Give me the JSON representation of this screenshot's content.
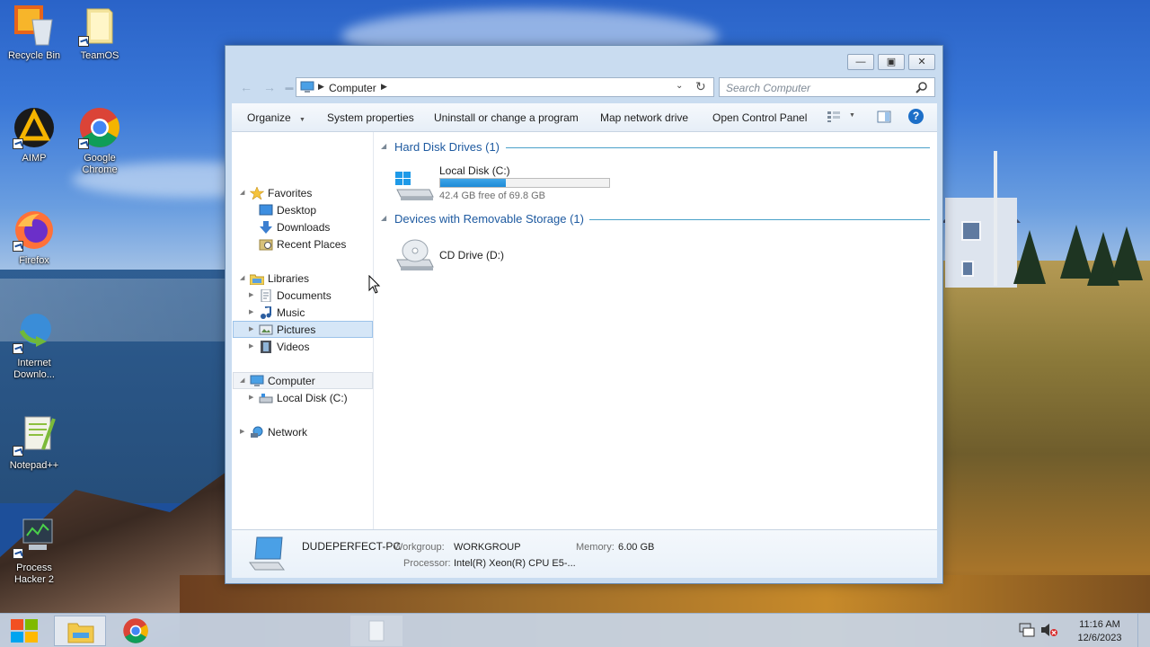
{
  "desktop": {
    "icons": [
      {
        "label": "Recycle Bin",
        "icon": "recycle-bin-icon"
      },
      {
        "label": "TeamOS",
        "icon": "folder-icon"
      },
      {
        "label": "AIMP",
        "icon": "aimp-icon"
      },
      {
        "label": "Google Chrome",
        "icon": "chrome-icon"
      },
      {
        "label": "Firefox",
        "icon": "firefox-icon"
      },
      {
        "label": "Internet Downlo...",
        "icon": "idm-icon"
      },
      {
        "label": "Notepad++",
        "icon": "notepadpp-icon"
      },
      {
        "label": "Process Hacker 2",
        "icon": "process-hacker-icon"
      }
    ]
  },
  "window": {
    "address": {
      "crumb": "Computer"
    },
    "search": {
      "placeholder": "Search Computer"
    },
    "toolbar": {
      "organize": "Organize",
      "system_properties": "System properties",
      "uninstall": "Uninstall or change a program",
      "map_drive": "Map network drive",
      "control_panel": "Open Control Panel"
    },
    "nav": {
      "favorites": "Favorites",
      "desktop": "Desktop",
      "downloads": "Downloads",
      "recent": "Recent Places",
      "libraries": "Libraries",
      "documents": "Documents",
      "music": "Music",
      "pictures": "Pictures",
      "videos": "Videos",
      "computer": "Computer",
      "local_disk": "Local Disk (C:)",
      "network": "Network"
    },
    "groups": {
      "hard_disks": "Hard Disk Drives (1)",
      "removable": "Devices with Removable Storage (1)"
    },
    "drives": {
      "c_name": "Local Disk (C:)",
      "c_free": "42.4 GB free of 69.8 GB",
      "c_used_fraction": 0.39,
      "d_name": "CD Drive (D:)"
    },
    "details": {
      "pc_name": "DUDEPERFECT-PC",
      "workgroup_label": "Workgroup:",
      "workgroup": "WORKGROUP",
      "memory_label": "Memory:",
      "memory": "6.00 GB",
      "processor_label": "Processor:",
      "processor": "Intel(R) Xeon(R) CPU E5-..."
    }
  },
  "taskbar": {
    "time": "11:16 AM",
    "date": "12/6/2023"
  },
  "colors": {
    "accent": "#1e5aa0",
    "progress": "#1e8ad6",
    "window_frame": "#c9dcf0"
  }
}
